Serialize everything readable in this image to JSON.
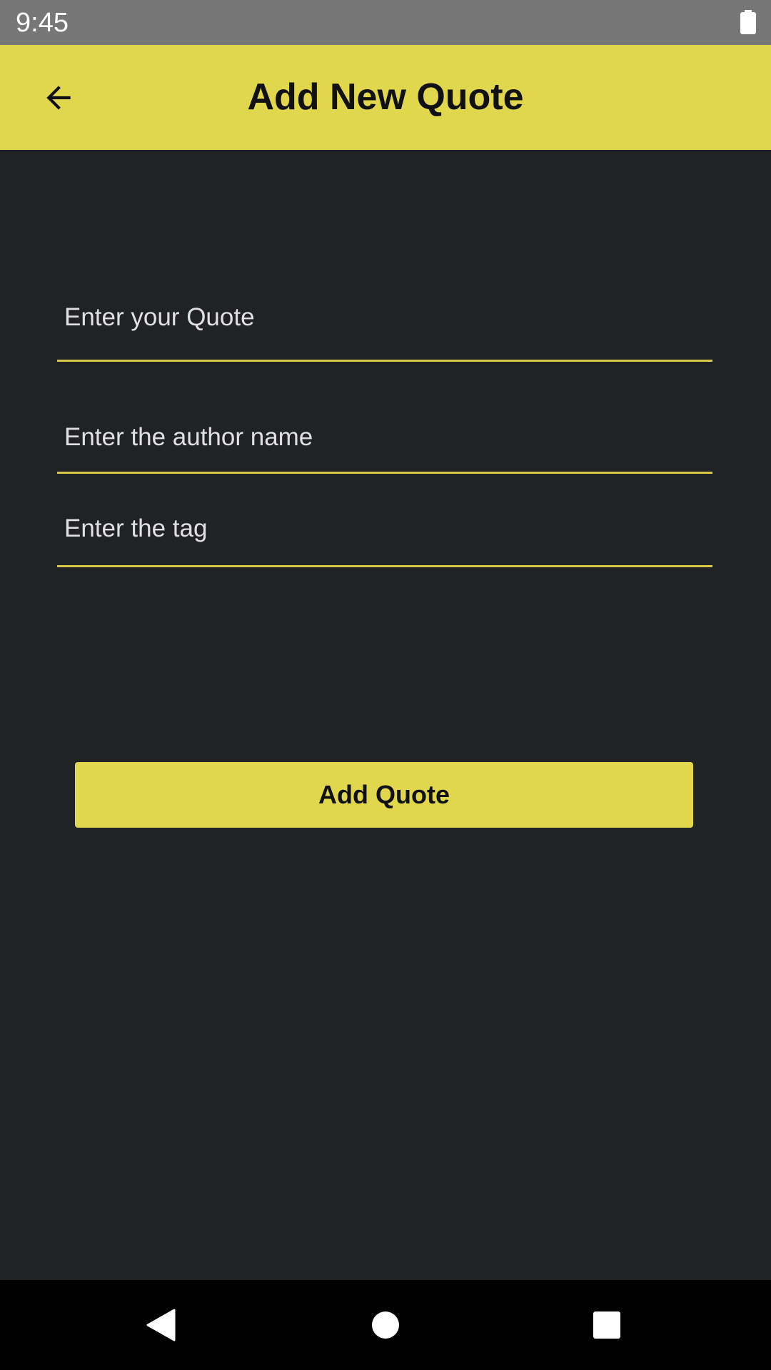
{
  "status_bar": {
    "time": "9:45",
    "battery_icon": "battery-full-icon"
  },
  "toolbar": {
    "title": "Add New Quote",
    "back_icon": "arrow-back-icon"
  },
  "form": {
    "quote_placeholder": "Enter your Quote",
    "author_placeholder": "Enter the author name",
    "tag_placeholder": "Enter the tag",
    "quote_value": "",
    "author_value": "",
    "tag_value": ""
  },
  "actions": {
    "add_quote_label": "Add Quote"
  },
  "nav_bar": {
    "back_icon": "triangle-back-icon",
    "home_icon": "circle-home-icon",
    "recents_icon": "square-recents-icon"
  },
  "colors": {
    "accent": "#e1d74d",
    "background": "#202225",
    "status_bar": "#777777",
    "nav_bar": "#000000"
  }
}
